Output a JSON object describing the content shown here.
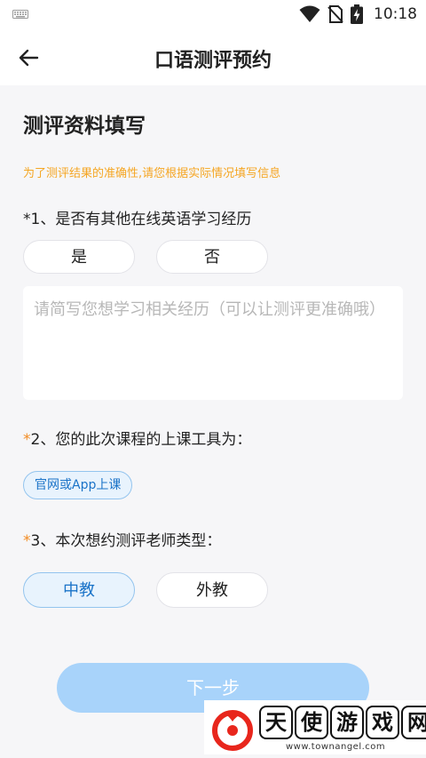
{
  "status_bar": {
    "time": "10:18",
    "icons": [
      "keyboard-icon",
      "wifi-icon",
      "no-sim-icon",
      "battery-charging-icon"
    ]
  },
  "header": {
    "back_icon": "back-arrow-icon",
    "title": "口语测评预约"
  },
  "form": {
    "section_title": "测评资料填写",
    "hint": "为了测评结果的准确性,请您根据实际情况填写信息",
    "q1": {
      "star": "*",
      "label": "1、是否有其他在线英语学习经历",
      "options": [
        "是",
        "否"
      ],
      "textarea_placeholder": "请简写您想学习相关经历（可以让测评更准确哦）",
      "textarea_value": ""
    },
    "q2": {
      "star": "*",
      "label": "2、您的此次课程的上课工具为：",
      "selected_tool": "官网或App上课"
    },
    "q3": {
      "star": "*",
      "label": "3、本次想约测评老师类型：",
      "options": [
        "中教",
        "外教"
      ],
      "selected": "中教"
    },
    "next_button": "下一步"
  },
  "watermark": {
    "chars": [
      "天",
      "使",
      "游",
      "戏",
      "网"
    ],
    "url": "www.townangel.com"
  },
  "colors": {
    "hint": "#f5a623",
    "accent_blue": "#1a73c8",
    "selected_bg": "#e8f3fd",
    "button_disabled": "#a8d3fa",
    "page_bg": "#f6f6f8"
  }
}
